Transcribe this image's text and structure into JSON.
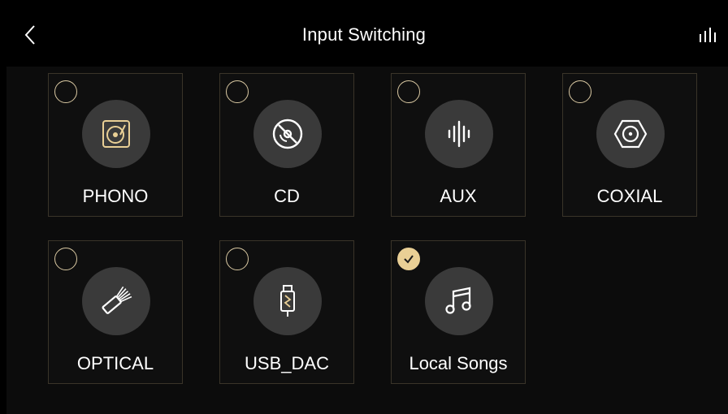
{
  "header": {
    "title": "Input Switching",
    "back_icon": "chevron-left-icon",
    "eq_icon": "equalizer-icon"
  },
  "colors": {
    "accent": "#e9cf95",
    "tile_border": "#3a3429",
    "icon_bg": "#3a3a3a",
    "background": "#000000"
  },
  "inputs": [
    {
      "label": "PHONO",
      "icon": "turntable-icon",
      "selected": false
    },
    {
      "label": "CD",
      "icon": "disc-icon",
      "selected": false
    },
    {
      "label": "AUX",
      "icon": "audio-wave-icon",
      "selected": false
    },
    {
      "label": "COXIAL",
      "icon": "coaxial-connector-icon",
      "selected": false
    },
    {
      "label": "OPTICAL",
      "icon": "optical-cable-icon",
      "selected": false
    },
    {
      "label": "USB_DAC",
      "icon": "usb-dac-icon",
      "selected": false
    },
    {
      "label": "Local Songs",
      "icon": "music-note-icon",
      "selected": true
    }
  ]
}
